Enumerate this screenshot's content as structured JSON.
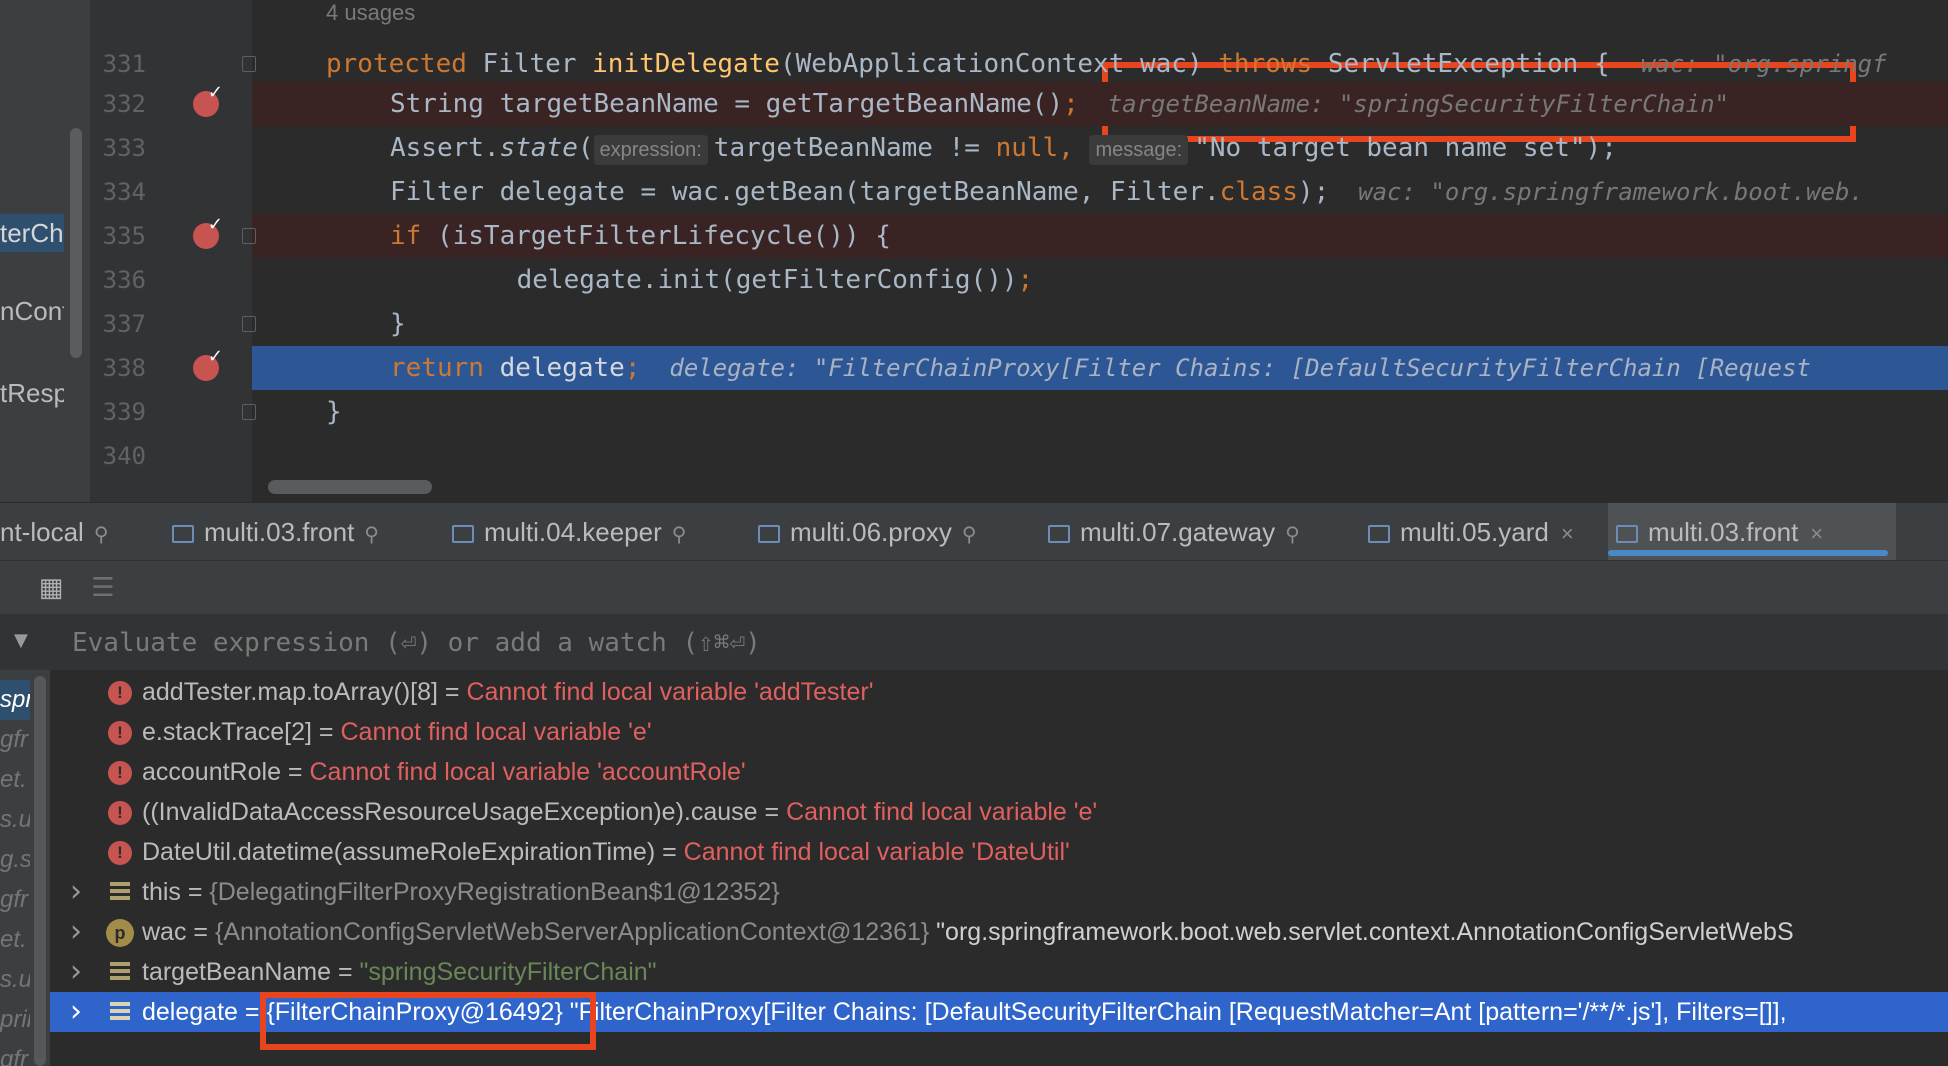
{
  "structure": {
    "items": [
      "terCh",
      "nCont",
      "tResp"
    ]
  },
  "editor": {
    "usages": "4 usages",
    "lines": [
      {
        "num": "331",
        "parts": [
          [
            "kw",
            "protected "
          ],
          [
            "",
            "Filter "
          ],
          [
            "fn",
            "initDelegate"
          ],
          [
            "",
            "(WebApplicationContext wac) "
          ],
          [
            "kw",
            "throws "
          ],
          [
            "",
            "ServletException {  "
          ]
        ],
        "hint": "wac: \"org.springf"
      },
      {
        "num": "332",
        "parts": [
          [
            "",
            "String targetBeanName = getTargetBeanName()"
          ],
          [
            "kw",
            ";"
          ]
        ],
        "hint": "  targetBeanName: \"springSecurityFilterChain\""
      },
      {
        "num": "333",
        "parts": [
          [
            "",
            "Assert."
          ],
          [
            "it",
            "state"
          ],
          [
            "",
            "("
          ],
          [
            "param",
            "expression:"
          ],
          [
            "",
            "targetBeanName != "
          ],
          [
            "kw",
            "null, "
          ],
          [
            "param",
            "message:"
          ],
          [
            "",
            "\"No target bean name set\");"
          ]
        ],
        "hint": ""
      },
      {
        "num": "334",
        "parts": [
          [
            "",
            "Filter delegate = wac.getBean(targetBeanName, Filter."
          ],
          [
            "kw",
            "class"
          ],
          [
            "",
            ");"
          ]
        ],
        "hint": "  wac: \"org.springframework.boot.web."
      },
      {
        "num": "335",
        "parts": [
          [
            "kw",
            "if "
          ],
          [
            "",
            "(isTargetFilterLifecycle()) {"
          ]
        ],
        "hint": ""
      },
      {
        "num": "336",
        "parts": [
          [
            "",
            "    delegate.init(getFilterConfig())"
          ],
          [
            "kw",
            ";"
          ]
        ],
        "hint": ""
      },
      {
        "num": "337",
        "parts": [
          [
            "",
            "}"
          ]
        ],
        "hint": ""
      },
      {
        "num": "338",
        "parts": [
          [
            "kw",
            "return "
          ],
          [
            "",
            "delegate"
          ],
          [
            "kw",
            ";"
          ]
        ],
        "hint": "  delegate: \"FilterChainProxy[Filter Chains: [DefaultSecurityFilterChain [Request"
      },
      {
        "num": "339",
        "parts": [
          [
            "",
            "}"
          ]
        ],
        "hint": ""
      },
      {
        "num": "340",
        "parts": [],
        "hint": ""
      }
    ]
  },
  "tabs": [
    {
      "label": "nt-local",
      "end": "pin"
    },
    {
      "label": "multi.03.front",
      "end": "pin"
    },
    {
      "label": "multi.04.keeper",
      "end": "pin"
    },
    {
      "label": "multi.06.proxy",
      "end": "pin"
    },
    {
      "label": "multi.07.gateway",
      "end": "pin"
    },
    {
      "label": "multi.05.yard",
      "end": "close"
    },
    {
      "label": "multi.03.front",
      "end": "close"
    }
  ],
  "toolbar": {
    "icons": [
      "table-icon",
      "settings-list-icon"
    ]
  },
  "evaluate": {
    "placeholder": "Evaluate expression (⏎) or add a watch (⇧⌘⏎)"
  },
  "frames": [
    "spri",
    "gfr",
    "et.",
    "s.ur",
    "g.s",
    "gfr",
    "et.",
    "s.ur",
    "prin",
    "gfr"
  ],
  "variables": [
    {
      "kind": "error",
      "name": "addTester.map.toArray()[8]",
      "eq": " = ",
      "value": "Cannot find local variable 'addTester'"
    },
    {
      "kind": "error",
      "name": "e.stackTrace[2]",
      "eq": " = ",
      "value": "Cannot find local variable 'e'"
    },
    {
      "kind": "error",
      "name": "accountRole",
      "eq": " = ",
      "value": "Cannot find local variable 'accountRole'"
    },
    {
      "kind": "error",
      "name": "((InvalidDataAccessResourceUsageException)e).cause",
      "eq": " = ",
      "value": "Cannot find local variable 'e'"
    },
    {
      "kind": "error",
      "name": "DateUtil.datetime(assumeRoleExpirationTime)",
      "eq": " = ",
      "value": "Cannot find local variable 'DateUtil'"
    },
    {
      "kind": "field",
      "name": "this",
      "eq": " = ",
      "obj": "{DelegatingFilterProxyRegistrationBean$1@12352}",
      "value": ""
    },
    {
      "kind": "param",
      "name": "wac",
      "eq": " = ",
      "obj": "{AnnotationConfigServletWebServerApplicationContext@12361}",
      "value": " \"org.springframework.boot.web.servlet.context.AnnotationConfigServletWebS"
    },
    {
      "kind": "field",
      "name": "targetBeanName",
      "eq": " = ",
      "obj": "",
      "value": "\"springSecurityFilterChain\""
    },
    {
      "kind": "field",
      "name": "delegate",
      "eq": " = ",
      "obj": "{FilterChainProxy@16492}",
      "value": " \"FilterChainProxy[Filter Chains: [DefaultSecurityFilterChain [RequestMatcher=Ant [pattern='/**/*.js'], Filters=[]],"
    }
  ]
}
